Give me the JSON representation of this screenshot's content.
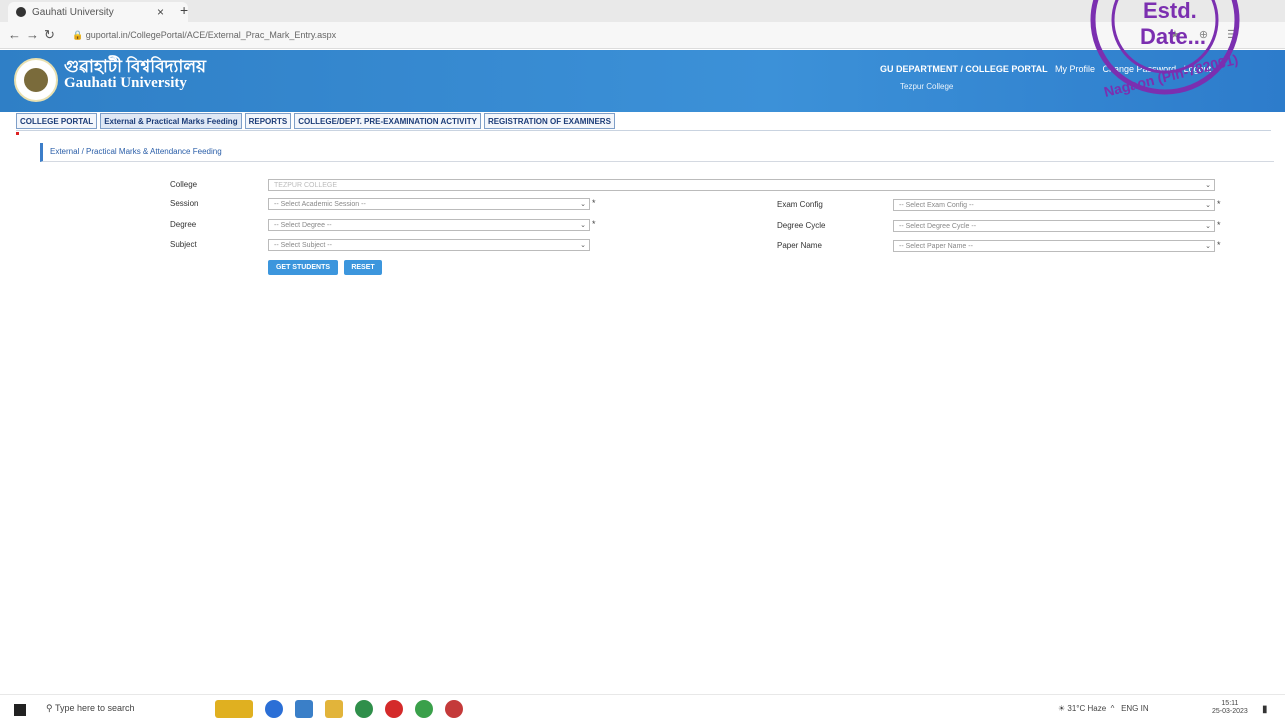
{
  "browser": {
    "tab_title": "Gauhati University",
    "url": "guportal.in/CollegePortal/ACE/External_Prac_Mark_Entry.aspx"
  },
  "header": {
    "title_assamese": "গুৱাহাটী বিশ্ববিদ্যালয়",
    "title_english": "Gauhati University",
    "portal_label": "GU DEPARTMENT / COLLEGE PORTAL",
    "user_info": "Tezpur College",
    "links": [
      "My Profile",
      "Change Password",
      "Logout"
    ]
  },
  "stamp": {
    "line1": "Estd.",
    "line2": "Date...",
    "ring_text": "Nagaon (Pin-782001)"
  },
  "menu": [
    "COLLEGE PORTAL",
    "External & Practical Marks Feeding",
    "REPORTS",
    "COLLEGE/DEPT. PRE-EXAMINATION ACTIVITY",
    "REGISTRATION OF EXAMINERS"
  ],
  "section": {
    "title": "External / Practical Marks & Attendance Feeding"
  },
  "form": {
    "college_label": "College",
    "college_value": "TEZPUR COLLEGE",
    "session_label": "Session",
    "session_placeholder": "-- Select Academic Session --",
    "degree_label": "Degree",
    "degree_placeholder": "-- Select Degree --",
    "subject_label": "Subject",
    "subject_placeholder": "-- Select Subject --",
    "exam_config_label": "Exam Config",
    "exam_config_placeholder": "-- Select Exam Config --",
    "degree_cycle_label": "Degree Cycle",
    "degree_cycle_placeholder": "-- Select Degree Cycle --",
    "paper_name_label": "Paper Name",
    "paper_name_placeholder": "-- Select Paper Name --",
    "required_mark": "*",
    "get_students_label": "GET STUDENTS",
    "reset_label": "RESET"
  },
  "taskbar": {
    "search_placeholder": "Type here to search",
    "weather": "31°C Haze",
    "lang": "ENG IN",
    "time": "15:11",
    "date": "25-03-2023"
  },
  "colors": {
    "header_blue": "#3c91d8",
    "button_blue": "#3c96dd",
    "stamp_purple": "#7b2fb0"
  }
}
